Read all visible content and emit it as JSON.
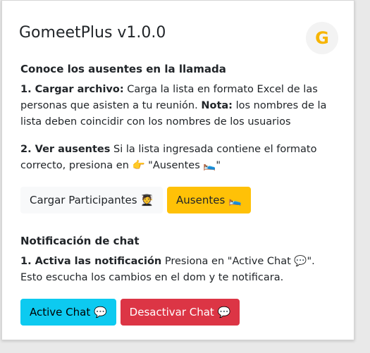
{
  "header": {
    "title": "GomeetPlus v1.0.0",
    "logo_letter": "G"
  },
  "section1": {
    "heading": "Conoce los ausentes en la llamada",
    "step1": {
      "label": "1. Cargar archivo:",
      "text1": " Carga la lista en formato Excel de las personas que asisten a tu reunión. ",
      "note_label": "Nota:",
      "text2": " los nombres de la lista deben coincidir con los nombres de los usuarios"
    },
    "step2": {
      "label": "2. Ver ausentes",
      "text": " Si la lista ingresada contiene el formato correcto, presiona en 👉 \"Ausentes 🛌\""
    },
    "buttons": {
      "load": "Cargar Participantes 🧑‍🎓",
      "absent": "Ausentes 🛌"
    }
  },
  "section2": {
    "heading": "Notificación de chat",
    "step1": {
      "label": "1. Activa las notificación",
      "text": " Presiona en \"Active Chat 💬\". Esto escucha los cambios en el dom y te notificara."
    },
    "buttons": {
      "activate": "Active Chat 💬",
      "deactivate": "Desactivar Chat 💬"
    }
  },
  "colors": {
    "warning": "#ffc107",
    "info": "#0dcaf0",
    "danger": "#dc3545",
    "light": "#f8f9fa",
    "logo": "#f7b500"
  }
}
